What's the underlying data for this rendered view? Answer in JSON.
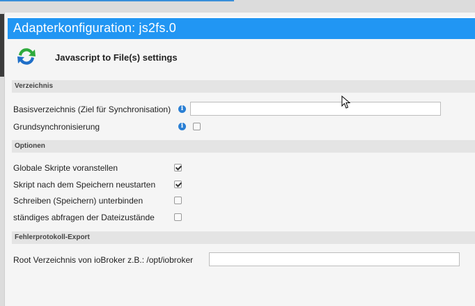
{
  "window": {
    "title": "Adapterkonfiguration: js2fs.0"
  },
  "header": {
    "title": "Javascript to File(s) settings",
    "logo_icon": "sync-arrows-icon"
  },
  "sections": {
    "directory": {
      "title": "Verzeichnis",
      "base_dir_label": "Basisverzeichnis (Ziel für Synchronisation)",
      "base_dir_value": "",
      "base_sync_label": "Grundsynchronisierung",
      "base_sync_checked": false
    },
    "options": {
      "title": "Optionen",
      "items": [
        {
          "label": "Globale Skripte voranstellen",
          "checked": true
        },
        {
          "label": "Skript nach dem Speichern neustarten",
          "checked": true
        },
        {
          "label": "Schreiben (Speichern) unterbinden",
          "checked": false
        },
        {
          "label": "ständiges abfragen der Dateizustände",
          "checked": false
        }
      ]
    },
    "error_export": {
      "title": "Fehlerprotokoll-Export",
      "root_label": "Root Verzeichnis von ioBroker z.B.: /opt/iobroker",
      "root_value": ""
    }
  },
  "colors": {
    "titlebar": "#2196f3",
    "info_icon": "#2a7fd4",
    "logo_green": "#2eaa3c",
    "logo_blue": "#1f6fc8"
  }
}
